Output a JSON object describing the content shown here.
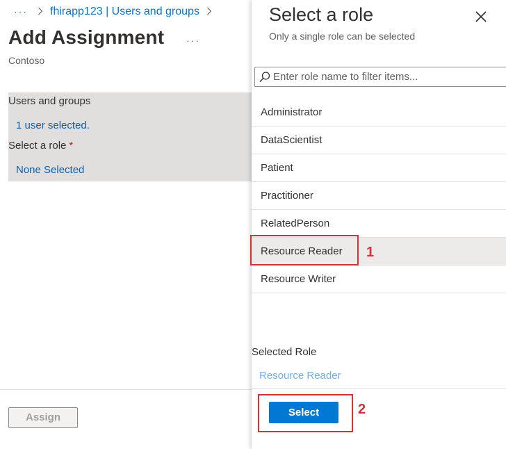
{
  "breadcrumb": {
    "more": "···",
    "link": "fhirapp123 | Users and groups"
  },
  "page": {
    "title": "Add Assignment",
    "more": "···",
    "subtitle": "Contoso"
  },
  "form": {
    "users_label": "Users and groups",
    "users_value": "1 user selected.",
    "role_label": "Select a role",
    "role_required": "*",
    "role_value": "None Selected"
  },
  "assign_button": "Assign",
  "panel": {
    "title": "Select a role",
    "subtitle": "Only a single role can be selected",
    "search": {
      "placeholder": "Enter role name to filter items..."
    },
    "roles": [
      {
        "label": "Administrator",
        "selected": false
      },
      {
        "label": "DataScientist",
        "selected": false
      },
      {
        "label": "Patient",
        "selected": false
      },
      {
        "label": "Practitioner",
        "selected": false
      },
      {
        "label": "RelatedPerson",
        "selected": false
      },
      {
        "label": "Resource Reader",
        "selected": true
      },
      {
        "label": "Resource Writer",
        "selected": false
      }
    ],
    "selected_role_label": "Selected Role",
    "selected_role_value": "Resource Reader",
    "select_button": "Select"
  },
  "annotations": [
    {
      "number": "1",
      "target": "Resource Reader"
    },
    {
      "number": "2",
      "target": "Select"
    }
  ],
  "colors": {
    "accent": "#0078d4",
    "link": "#0f5fa8",
    "selected_value": "#71afe5",
    "form_background": "#e1dfdd",
    "annotation": "#d13438"
  },
  "icons": {
    "close": "close-icon",
    "search": "search-icon",
    "breadcrumb_separator": "chevron-right-icon"
  }
}
